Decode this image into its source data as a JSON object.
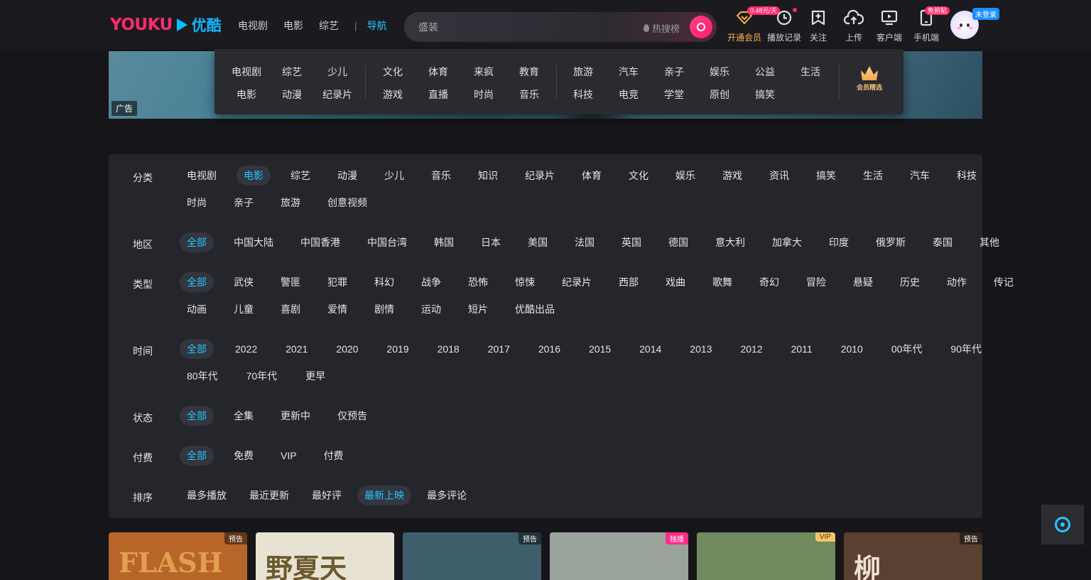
{
  "header": {
    "logo_en": "YOUKU",
    "logo_cn": "优酷",
    "nav": [
      "电视剧",
      "电影",
      "综艺"
    ],
    "nav_active": "导航",
    "search": {
      "placeholder": "盛装",
      "hot_label": "热搜榜"
    },
    "tools": [
      {
        "label": "开通会员",
        "icon": "vip-diamond-icon",
        "badge": "0.48元/天"
      },
      {
        "label": "播放记录",
        "icon": "history-icon"
      },
      {
        "label": "关注",
        "icon": "follow-icon"
      },
      {
        "label": "上传",
        "icon": "upload-icon"
      },
      {
        "label": "客户端",
        "icon": "client-icon"
      },
      {
        "label": "手机端",
        "icon": "phone-icon",
        "badge": "免前贴"
      }
    ],
    "login_tag": "未登录"
  },
  "banner": {
    "ad_label": "广告"
  },
  "dropdown": {
    "groups": [
      [
        [
          "电视剧",
          "电影"
        ],
        [
          "综艺",
          "动漫"
        ],
        [
          "少儿",
          "纪录片"
        ]
      ],
      [
        [
          "文化",
          "游戏"
        ],
        [
          "体育",
          "直播"
        ],
        [
          "来疯",
          "时尚"
        ],
        [
          "教育",
          "音乐"
        ]
      ],
      [
        [
          "旅游",
          "科技"
        ],
        [
          "汽车",
          "电竞"
        ],
        [
          "亲子",
          "学堂"
        ],
        [
          "娱乐",
          "原创"
        ],
        [
          "公益",
          "搞笑"
        ],
        [
          "生活",
          ""
        ]
      ]
    ],
    "vip_pick": "会员精选"
  },
  "filters": [
    {
      "label": "分类",
      "rows": [
        [
          "电视剧",
          "电影",
          "综艺",
          "动漫",
          "少儿",
          "音乐",
          "知识",
          "纪录片",
          "体育",
          "文化",
          "娱乐",
          "游戏",
          "资讯",
          "搞笑",
          "生活",
          "汽车",
          "科技"
        ],
        [
          "时尚",
          "亲子",
          "旅游",
          "创意视频"
        ]
      ],
      "selected": "电影"
    },
    {
      "label": "地区",
      "rows": [
        [
          "全部",
          "中国大陆",
          "中国香港",
          "中国台湾",
          "韩国",
          "日本",
          "美国",
          "法国",
          "英国",
          "德国",
          "意大利",
          "加拿大",
          "印度",
          "俄罗斯",
          "泰国",
          "其他"
        ]
      ],
      "selected": "全部"
    },
    {
      "label": "类型",
      "rows": [
        [
          "全部",
          "武侠",
          "警匪",
          "犯罪",
          "科幻",
          "战争",
          "恐怖",
          "惊悚",
          "纪录片",
          "西部",
          "戏曲",
          "歌舞",
          "奇幻",
          "冒险",
          "悬疑",
          "历史",
          "动作",
          "传记"
        ],
        [
          "动画",
          "儿童",
          "喜剧",
          "爱情",
          "剧情",
          "运动",
          "短片",
          "优酷出品"
        ]
      ],
      "selected": "全部"
    },
    {
      "label": "时间",
      "rows": [
        [
          "全部",
          "2022",
          "2021",
          "2020",
          "2019",
          "2018",
          "2017",
          "2016",
          "2015",
          "2014",
          "2013",
          "2012",
          "2011",
          "2010",
          "00年代",
          "90年代"
        ],
        [
          "80年代",
          "70年代",
          "更早"
        ]
      ],
      "selected": "全部"
    },
    {
      "label": "状态",
      "rows": [
        [
          "全部",
          "全集",
          "更新中",
          "仅预告"
        ]
      ],
      "selected": "全部"
    },
    {
      "label": "付费",
      "rows": [
        [
          "全部",
          "免费",
          "VIP",
          "付费"
        ]
      ],
      "selected": "全部"
    },
    {
      "label": "排序",
      "rows": [
        [
          "最多播放",
          "最近更新",
          "最好评",
          "最新上映",
          "最多评论"
        ]
      ],
      "selected": "最新上映"
    }
  ],
  "cards": [
    {
      "badge": "预告",
      "badge_type": "normal",
      "text": "FLASH",
      "bg": "#b8652a",
      "fg": "#e0a050"
    },
    {
      "badge": "",
      "badge_type": "none",
      "text": "野夏天",
      "bg": "#e8e2d2",
      "fg": "#6b5a2e"
    },
    {
      "badge": "预告",
      "badge_type": "normal",
      "text": "",
      "bg": "#3d5e6a",
      "fg": "#fff"
    },
    {
      "badge": "独播",
      "badge_type": "exclusive",
      "text": "",
      "bg": "#9aa49c",
      "fg": "#fff"
    },
    {
      "badge": "VIP",
      "badge_type": "vip",
      "text": "",
      "bg": "#6f8a5e",
      "fg": "#fff"
    },
    {
      "badge": "预告",
      "badge_type": "normal",
      "text": "柳",
      "bg": "#5a4030",
      "fg": "#f0e0d0"
    }
  ],
  "colors": {
    "accent": "#26c6ff",
    "brand_pink": "#ff2b6f",
    "vip_gold": "#ffb34d",
    "panel": "#25252c",
    "bg": "#16161a"
  }
}
